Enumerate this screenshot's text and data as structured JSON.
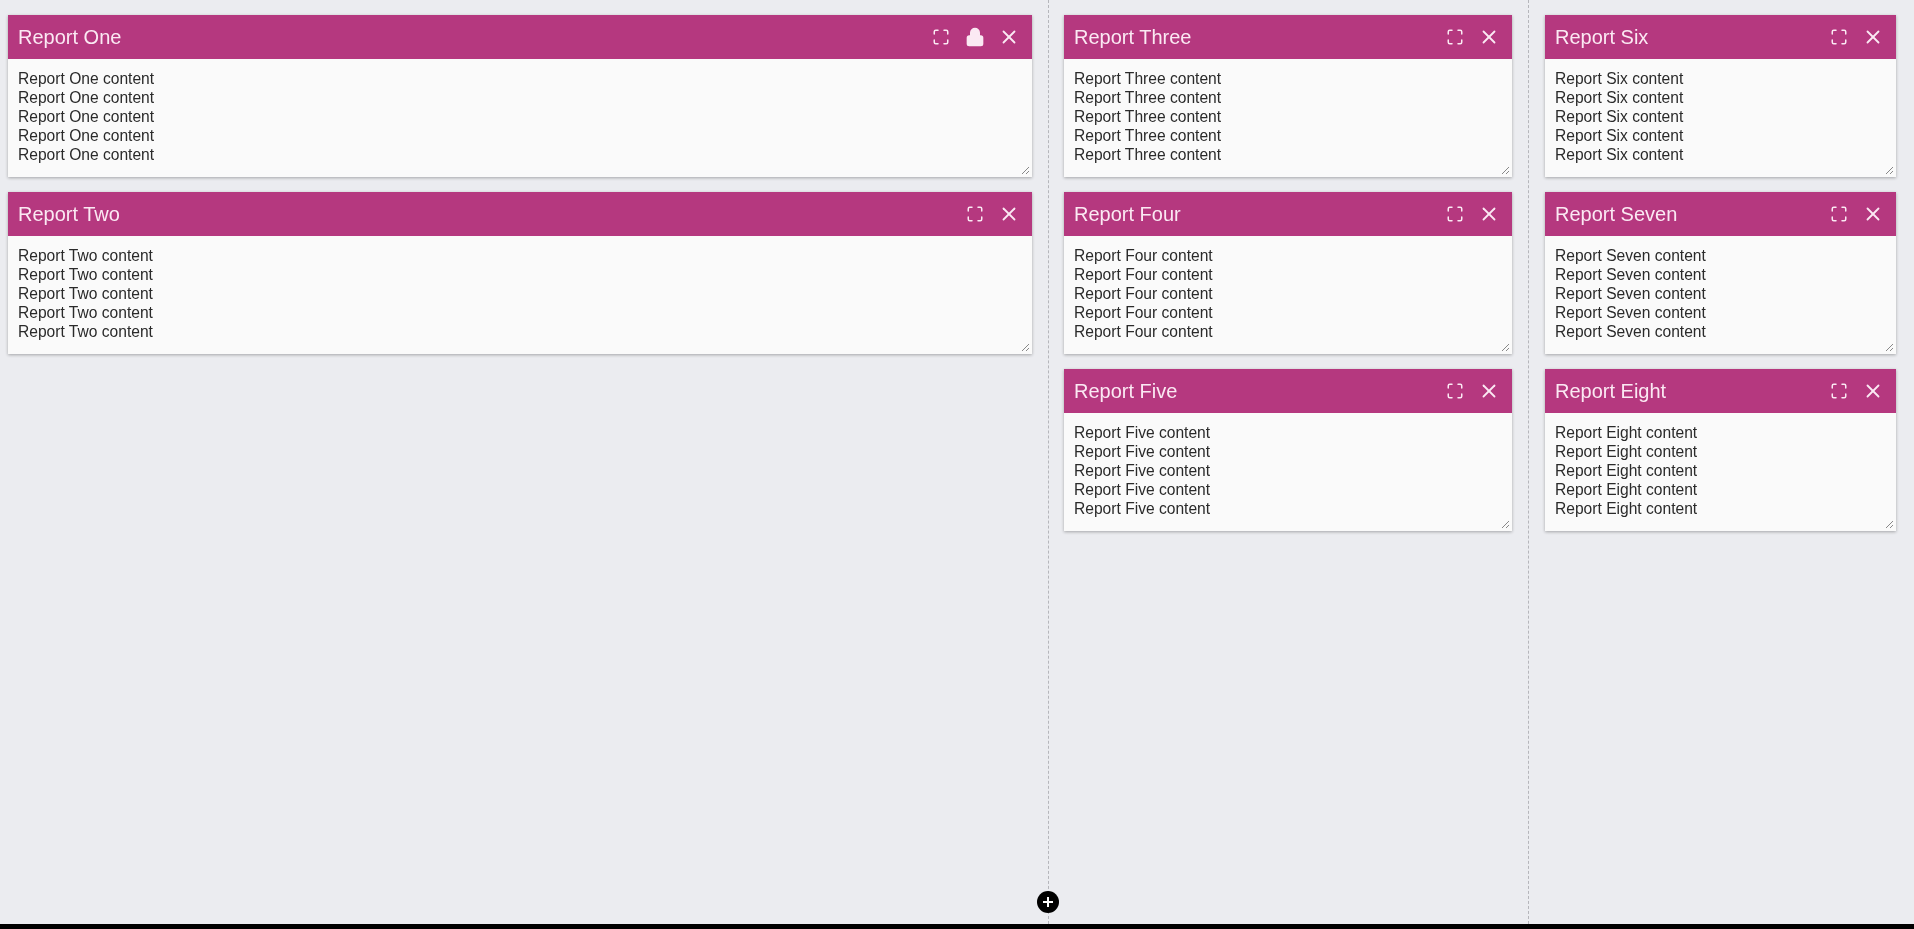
{
  "columns": [
    {
      "cards": [
        {
          "title": "Report One",
          "locked": true,
          "lines": [
            "Report One content",
            "Report One content",
            "Report One content",
            "Report One content",
            "Report One content"
          ]
        },
        {
          "title": "Report Two",
          "locked": false,
          "lines": [
            "Report Two content",
            "Report Two content",
            "Report Two content",
            "Report Two content",
            "Report Two content"
          ]
        }
      ]
    },
    {
      "cards": [
        {
          "title": "Report Three",
          "locked": false,
          "lines": [
            "Report Three content",
            "Report Three content",
            "Report Three content",
            "Report Three content",
            "Report Three content"
          ]
        },
        {
          "title": "Report Four",
          "locked": false,
          "lines": [
            "Report Four content",
            "Report Four content",
            "Report Four content",
            "Report Four content",
            "Report Four content"
          ]
        },
        {
          "title": "Report Five",
          "locked": false,
          "lines": [
            "Report Five content",
            "Report Five content",
            "Report Five content",
            "Report Five content",
            "Report Five content"
          ]
        }
      ]
    },
    {
      "cards": [
        {
          "title": "Report Six",
          "locked": false,
          "lines": [
            "Report Six content",
            "Report Six content",
            "Report Six content",
            "Report Six content",
            "Report Six content"
          ]
        },
        {
          "title": "Report Seven",
          "locked": false,
          "lines": [
            "Report Seven content",
            "Report Seven content",
            "Report Seven content",
            "Report Seven content",
            "Report Seven content"
          ]
        },
        {
          "title": "Report Eight",
          "locked": false,
          "lines": [
            "Report Eight content",
            "Report Eight content",
            "Report Eight content",
            "Report Eight content",
            "Report Eight content"
          ]
        }
      ]
    }
  ]
}
